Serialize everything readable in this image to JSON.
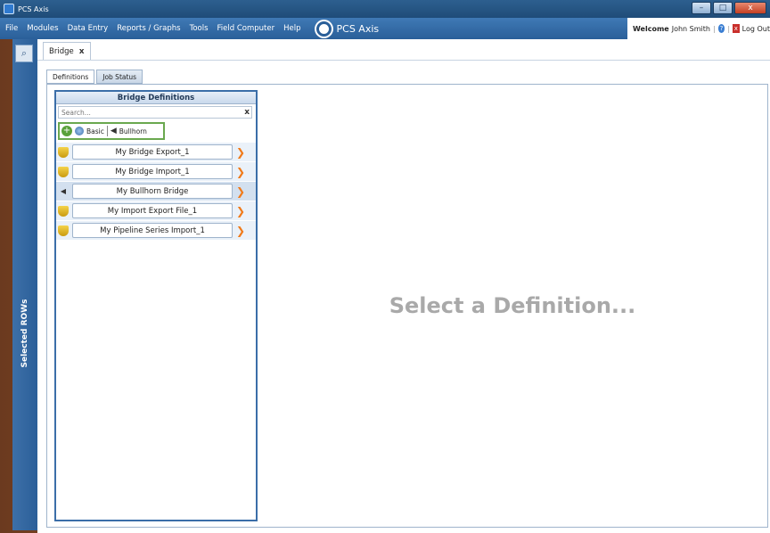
{
  "window": {
    "title": "PCS Axis",
    "minimize": "–",
    "maximize": "□",
    "close": "x"
  },
  "menu": {
    "items": [
      "File",
      "Modules",
      "Data Entry",
      "Reports / Graphs",
      "Tools",
      "Field Computer",
      "Help"
    ],
    "brand": "PCS Axis",
    "welcome_prefix": "Welcome",
    "user_name": "John Smith",
    "logout": "Log Out"
  },
  "left_rail": {
    "label": "Selected ROWs"
  },
  "doc_tab": {
    "label": "Bridge",
    "close": "x"
  },
  "inner_tabs": [
    "Definitions",
    "Job Status"
  ],
  "definitions": {
    "header": "Bridge Definitions",
    "search_placeholder": "Search...",
    "filter": {
      "basic": "Basic",
      "bullhorn": "Bullhorn"
    },
    "items": [
      {
        "label": "My Bridge Export_1",
        "icon": "shield-icon"
      },
      {
        "label": "My Bridge Import_1",
        "icon": "shield-icon"
      },
      {
        "label": "My Bullhorn Bridge",
        "icon": "bullhorn-icon"
      },
      {
        "label": "My Import Export File_1",
        "icon": "shield-icon"
      },
      {
        "label": "My Pipeline Series Import_1",
        "icon": "shield-icon"
      }
    ]
  },
  "placeholder": "Select a Definition...",
  "colors": {
    "accent": "#2a5f99",
    "arrow": "#f07a1a",
    "filter_border": "#6aa84f"
  }
}
